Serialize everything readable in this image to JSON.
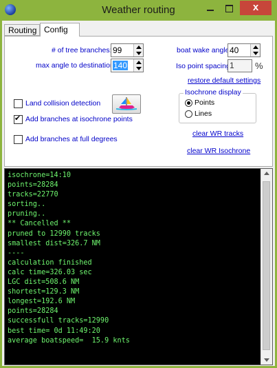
{
  "window": {
    "title": "Weather routing",
    "close_label": "x"
  },
  "tabs": [
    {
      "label": "Routing"
    },
    {
      "label": "Config"
    }
  ],
  "config": {
    "tree_branches": {
      "label": "# of tree branches:",
      "value": "99"
    },
    "max_angle": {
      "label": "max angle to destination:",
      "value": "140"
    },
    "boat_wake": {
      "label": "boat wake angle:",
      "value": "40"
    },
    "iso_spacing": {
      "label": "Iso point spacing:",
      "value": "1",
      "unit": "%"
    },
    "restore_defaults": "restore default settings",
    "land_collision": {
      "label": "Land collision detection",
      "checked": false
    },
    "branches_isochrone": {
      "label": "Add branches at isochrone points",
      "checked": true
    },
    "branches_full_degrees": {
      "label": "Add branches at full degrees",
      "checked": false
    },
    "isochrone_display": {
      "title": "Isochrone display",
      "options": [
        {
          "label": "Points",
          "selected": true
        },
        {
          "label": "Lines",
          "selected": false
        }
      ]
    },
    "clear_wr_tracks": "clear WR tracks",
    "clear_wr_isochrone": "clear WR  Isochrone"
  },
  "console": {
    "lines": [
      "isochrone=14:10",
      "points=28284",
      "tracks=22770",
      "sorting..",
      "pruning..",
      "** Cancelled **",
      "pruned to 12990 tracks",
      "smallest dist=326.7 NM",
      "----",
      "calculation finished",
      "calc time=326.03 sec",
      "LGC dist=508.6 NM",
      "shortest=129.3 NM",
      "longest=192.6 NM",
      "points=28284",
      "successfull tracks=12990",
      "best time= 0d 11:49:20",
      "average boatspeed=  15.9 knts"
    ]
  },
  "colors": {
    "titlebar": "#8db43e",
    "label_blue": "#0000c8",
    "console_text": "#6ef56e",
    "close_red": "#c7463a"
  }
}
